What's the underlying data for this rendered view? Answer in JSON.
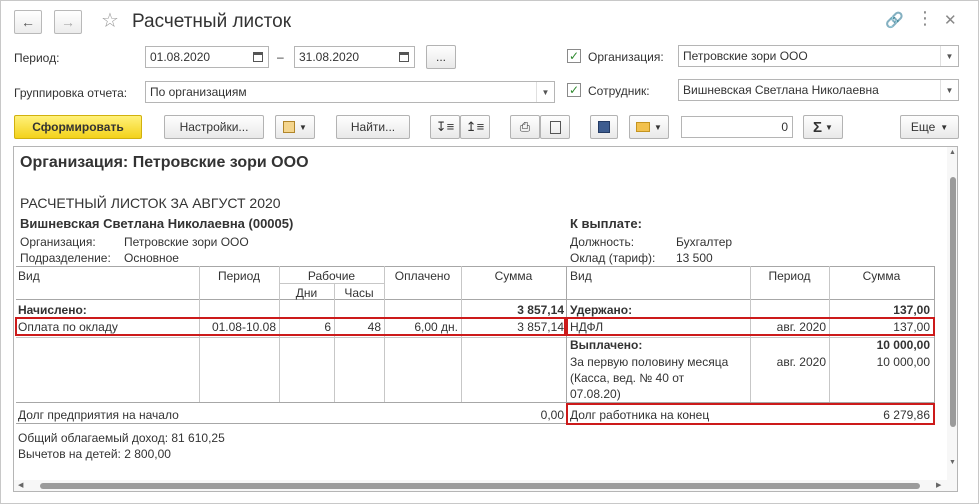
{
  "window": {
    "title": "Расчетный листок"
  },
  "form": {
    "period_label": "Период:",
    "date_from": "01.08.2020",
    "dash": "–",
    "date_to": "31.08.2020",
    "more_label": "...",
    "grouping_label": "Группировка отчета:",
    "grouping_value": "По организациям",
    "org_label": "Организация:",
    "org_value": "Петровские зори ООО",
    "emp_label": "Сотрудник:",
    "emp_value": "Вишневская Светлана Николаевна"
  },
  "toolbar": {
    "generate": "Сформировать",
    "settings": "Настройки...",
    "find": "Найти...",
    "sum_value": "0",
    "sigma": "Σ",
    "more": "Еще"
  },
  "report": {
    "org_title": "Организация: Петровские зори ООО",
    "sheet_title": "РАСЧЕТНЫЙ ЛИСТОК ЗА АВГУСТ 2020",
    "employee": "Вишневская Светлана Николаевна (00005)",
    "info_org_label": "Организация:",
    "info_org_value": "Петровские зори ООО",
    "info_dept_label": "Подразделение:",
    "info_dept_value": "Основное",
    "to_pay": "К выплате:",
    "position_label": "Должность:",
    "position_value": "Бухгалтер",
    "salary_label": "Оклад (тариф):",
    "salary_value": "13 500",
    "headers": {
      "kind": "Вид",
      "period": "Период",
      "working": "Рабочие",
      "days": "Дни",
      "hours": "Часы",
      "paid": "Оплачено",
      "sum": "Сумма",
      "kind_r": "Вид",
      "period_r": "Период",
      "sum_r": "Сумма"
    },
    "accrued_label": "Начислено:",
    "accrued_total": "3 857,14",
    "withheld_label": "Удержано:",
    "withheld_total": "137,00",
    "row1": {
      "kind": "Оплата по окладу",
      "period": "01.08-10.08",
      "days": "6",
      "hours": "48",
      "paid": "6,00 дн.",
      "sum": "3 857,14"
    },
    "row1r": {
      "kind": "НДФЛ",
      "period": "авг. 2020",
      "sum": "137,00"
    },
    "paid_out_label": "Выплачено:",
    "paid_out_total": "10 000,00",
    "payout_line1": "За первую половину месяца",
    "payout_line2": "(Касса, вед. № 40 от",
    "payout_line3": "07.08.20)",
    "payout_period": "авг. 2020",
    "payout_sum": "10 000,00",
    "debt_start_label": "Долг предприятия на начало",
    "debt_start_value": "0,00",
    "debt_end_label": "Долг работника на конец",
    "debt_end_value": "6 279,86",
    "taxable_income": "Общий облагаемый доход: 81 610,25",
    "child_deductions": "Вычетов на детей: 2 800,00"
  }
}
